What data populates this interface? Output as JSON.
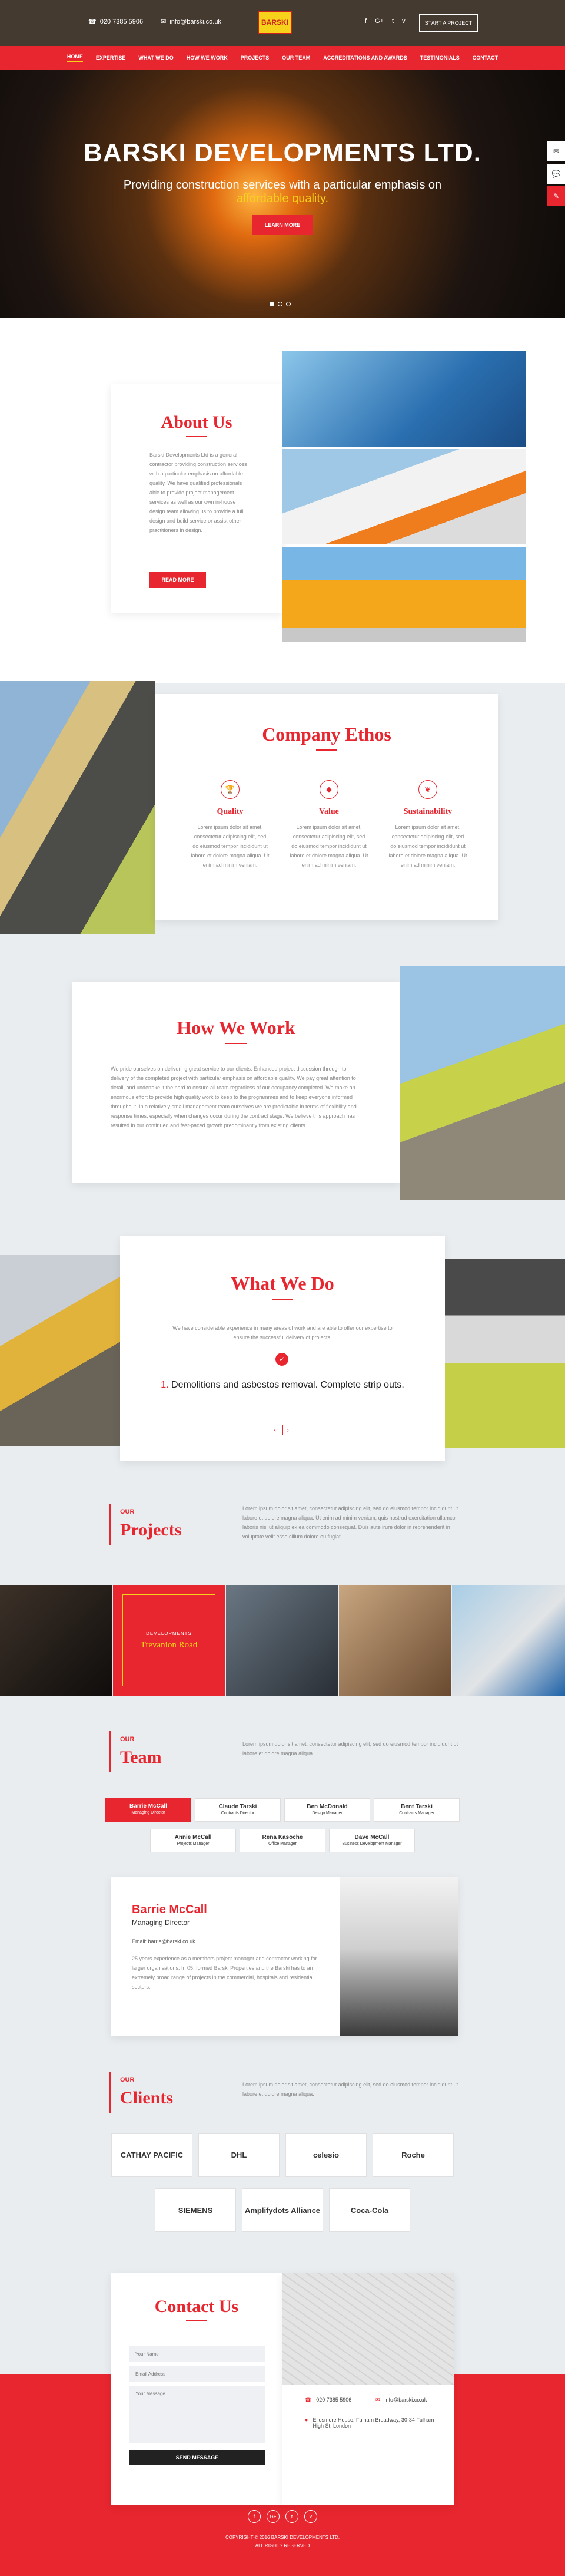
{
  "header": {
    "phone": "020 7385 5906",
    "email": "info@barski.co.uk",
    "logo_text": "BARSKI",
    "social_icons": [
      "facebook-icon",
      "google-plus-icon",
      "twitter-icon",
      "vimeo-icon"
    ],
    "cta": "START A PROJECT"
  },
  "nav": {
    "items": [
      "HOME",
      "EXPERTISE",
      "WHAT WE DO",
      "HOW WE WORK",
      "PROJECTS",
      "OUR TEAM",
      "ACCREDITATIONS AND AWARDS",
      "TESTIMONIALS",
      "CONTACT"
    ],
    "active_index": 0
  },
  "hero": {
    "title": "BARSKI DEVELOPMENTS LTD.",
    "subtitle": "Providing construction services with a particular emphasis on",
    "highlight": "affordable quality.",
    "button": "LEARN MORE",
    "slide_count": 3
  },
  "side_tabs": [
    "mail-icon",
    "chat-icon",
    "tools-icon"
  ],
  "about": {
    "title": "About Us",
    "body": "Barski Developments Ltd is a general contractor providing construction services with a particular emphasis on affordable quality. We have qualified professionals able to provide project management services as well as our own in-house design team allowing us to provide a full design and build service or assist other practitioners in design.",
    "button": "READ MORE"
  },
  "ethos": {
    "title": "Company Ethos",
    "items": [
      {
        "title": "Quality",
        "icon": "trophy-icon",
        "body": "Lorem ipsum dolor sit amet, consectetur adipiscing elit, sed do eiusmod tempor incididunt ut labore et dolore magna aliqua. Ut enim ad minim veniam."
      },
      {
        "title": "Value",
        "icon": "diamond-icon",
        "body": "Lorem ipsum dolor sit amet, consectetur adipiscing elit, sed do eiusmod tempor incididunt ut labore et dolore magna aliqua. Ut enim ad minim veniam."
      },
      {
        "title": "Sustainability",
        "icon": "leaf-icon",
        "body": "Lorem ipsum dolor sit amet, consectetur adipiscing elit, sed do eiusmod tempor incididunt ut labore et dolore magna aliqua. Ut enim ad minim veniam."
      }
    ]
  },
  "how": {
    "title": "How We Work",
    "body": "We pride ourselves on delivering great service to our clients. Enhanced project discussion through to delivery of the completed project with particular emphasis on affordable quality. We pay great attention to detail, and undertake it the hard to ensure all team regardless of our occupancy completed. We make an enormous effort to provide high quality work to keep to the programmes and to keep everyone informed throughout. In a relatively small management team ourselves we are predictable in terms of flexibility and response times, especially when changes occur during the contract stage. We believe this approach has resulted in our continued and fast-paced growth predominantly from existing clients."
  },
  "what": {
    "title": "What We Do",
    "intro": "We have considerable experience in many areas of work and are able to offer our expertise to ensure the successful delivery of projects.",
    "item_number": "1.",
    "item_text": "Demolitions and asbestos removal. Complete strip outs."
  },
  "projects": {
    "eyebrow": "OUR",
    "title": "Projects",
    "intro": "Lorem ipsum dolor sit amet, consectetur adipiscing elit, sed do eiusmod tempor incididunt ut labore et dolore magna aliqua. Ut enim ad minim veniam, quis nostrud exercitation ullamco laboris nisi ut aliquip ex ea commodo consequat. Duis aute irure dolor in reprehenderit in voluptate velit esse cillum dolore eu fugiat.",
    "feature_label": "DEVELOPMENTS",
    "feature_title": "Trevanion Road"
  },
  "team": {
    "eyebrow": "OUR",
    "title": "Team",
    "intro": "Lorem ipsum dolor sit amet, consectetur adipiscing elit, sed do eiusmod tempor incididunt ut labore et dolore magna aliqua.",
    "members": [
      {
        "name": "Barrie McCall",
        "role": "Managing Director"
      },
      {
        "name": "Claude Tarski",
        "role": "Contracts Director"
      },
      {
        "name": "Ben McDonald",
        "role": "Design Manager"
      },
      {
        "name": "Bent Tarski",
        "role": "Contracts Manager"
      },
      {
        "name": "Annie McCall",
        "role": "Projects Manager"
      },
      {
        "name": "Rena Kasoche",
        "role": "Office Manager"
      },
      {
        "name": "Dave McCall",
        "role": "Business Development Manager"
      }
    ],
    "active_index": 0,
    "profile": {
      "name": "Barrie McCall",
      "role": "Managing Director",
      "email": "Email: barrie@barski.co.uk",
      "bio": "25 years experience as a members project manager and contractor working for larger organisations. In 05, formed Barski Properties and the Barski has to an extremely broad range of projects in the commercial, hospitals and residential sectors."
    }
  },
  "clients": {
    "eyebrow": "OUR",
    "title": "Clients",
    "intro": "Lorem ipsum dolor sit amet, consectetur adipiscing elit, sed do eiusmod tempor incididunt ut labore et dolore magna aliqua.",
    "logos": [
      "CATHAY PACIFIC",
      "DHL",
      "celesio",
      "Roche",
      "SIEMENS",
      "Amplifydots Alliance",
      "Coca-Cola"
    ]
  },
  "contact": {
    "title": "Contact Us",
    "fields": [
      "Your Name",
      "Email Address",
      "Your Message"
    ],
    "button": "SEND MESSAGE",
    "phone": "020 7385 5906",
    "email": "info@barski.co.uk",
    "address": "Ellesmere House, Fulham Broadway, 30-34 Fulham High St, London"
  },
  "footer": {
    "social_icons": [
      "facebook-icon",
      "google-plus-icon",
      "twitter-icon",
      "vimeo-icon"
    ],
    "copyright": "COPYRIGHT © 2016 BARSKI DEVELOPMENTS LTD.",
    "rights": "ALL RIGHTS RESERVED"
  },
  "colors": {
    "accent": "#e8262f",
    "yellow": "#f7d21a",
    "background": "#e9edf0"
  }
}
